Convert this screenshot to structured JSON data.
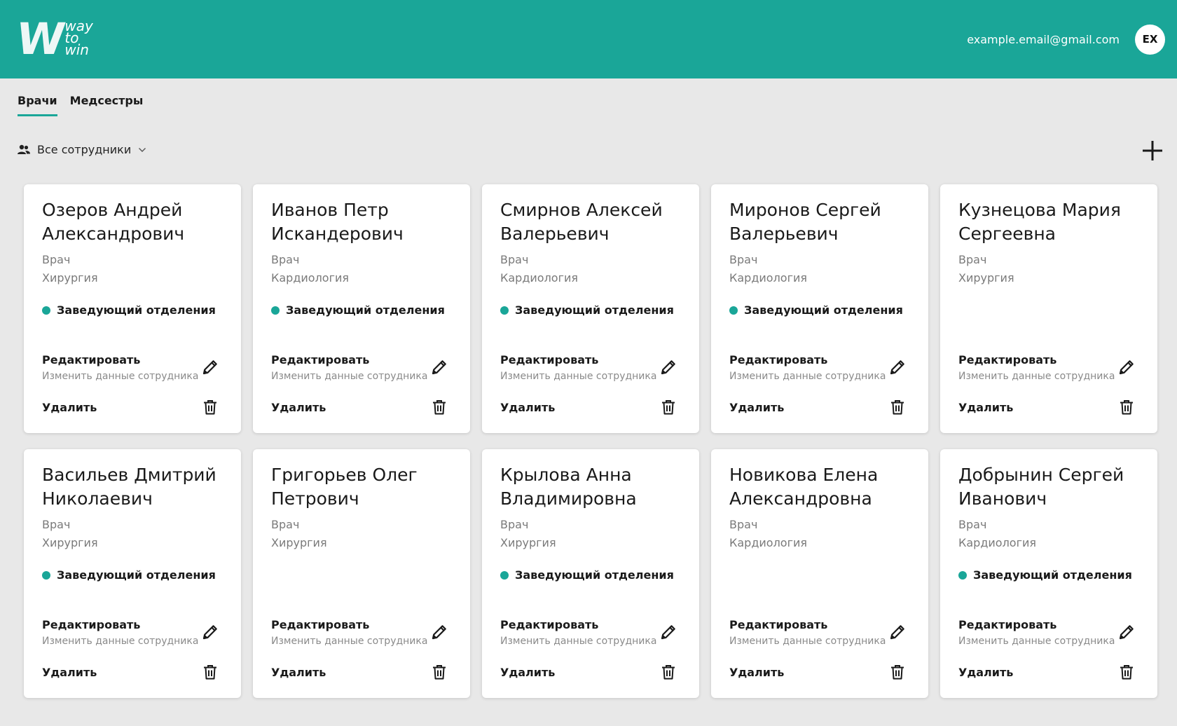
{
  "header": {
    "logo_mark": "W",
    "logo_words": [
      "way",
      "to",
      "win"
    ],
    "email": "example.email@gmail.com",
    "avatar_initials": "EX",
    "background_color": "#1aa698"
  },
  "tabs": [
    {
      "label": "Врачи",
      "active": true
    },
    {
      "label": "Медсестры",
      "active": false
    }
  ],
  "filter": {
    "icon": "people-icon",
    "label": "Все сотрудники",
    "dropdown_icon": "chevron-down-icon"
  },
  "add_button": {
    "icon": "plus-icon"
  },
  "accent_color": "#1aa698",
  "cards": [
    {
      "name": "Озеров Андрей Александрович",
      "position": "Врач",
      "department": "Хирургия",
      "status": "Заведующий отделения",
      "edit_label": "Редактировать",
      "edit_sub": "Изменить данные сотрудника",
      "delete_label": "Удалить"
    },
    {
      "name": "Иванов Петр Искандерович",
      "position": "Врач",
      "department": "Кардиология",
      "status": "Заведующий отделения",
      "edit_label": "Редактировать",
      "edit_sub": "Изменить данные сотрудника",
      "delete_label": "Удалить"
    },
    {
      "name": "Смирнов Алексей Валерьевич",
      "position": "Врач",
      "department": "Кардиология",
      "status": "Заведующий отделения",
      "edit_label": "Редактировать",
      "edit_sub": "Изменить данные сотрудника",
      "delete_label": "Удалить"
    },
    {
      "name": "Миронов Сергей Валерьевич",
      "position": "Врач",
      "department": "Кардиология",
      "status": "Заведующий отделения",
      "edit_label": "Редактировать",
      "edit_sub": "Изменить данные сотрудника",
      "delete_label": "Удалить"
    },
    {
      "name": "Кузнецова Мария Сергеевна",
      "position": "Врач",
      "department": "Хирургия",
      "status": "",
      "edit_label": "Редактировать",
      "edit_sub": "Изменить данные сотрудника",
      "delete_label": "Удалить"
    },
    {
      "name": "Васильев Дмитрий Николаевич",
      "position": "Врач",
      "department": "Хирургия",
      "status": "Заведующий отделения",
      "edit_label": "Редактировать",
      "edit_sub": "Изменить данные сотрудника",
      "delete_label": "Удалить"
    },
    {
      "name": "Григорьев Олег Петрович",
      "position": "Врач",
      "department": "Хирургия",
      "status": "",
      "edit_label": "Редактировать",
      "edit_sub": "Изменить данные сотрудника",
      "delete_label": "Удалить"
    },
    {
      "name": "Крылова Анна Владимировна",
      "position": "Врач",
      "department": "Хирургия",
      "status": "Заведующий отделения",
      "edit_label": "Редактировать",
      "edit_sub": "Изменить данные сотрудника",
      "delete_label": "Удалить"
    },
    {
      "name": "Новикова Елена Александровна",
      "position": "Врач",
      "department": "Кардиология",
      "status": "",
      "edit_label": "Редактировать",
      "edit_sub": "Изменить данные сотрудника",
      "delete_label": "Удалить"
    },
    {
      "name": "Добрынин Сергей Иванович",
      "position": "Врач",
      "department": "Кардиология",
      "status": "Заведующий отделения",
      "edit_label": "Редактировать",
      "edit_sub": "Изменить данные сотрудника",
      "delete_label": "Удалить"
    }
  ]
}
